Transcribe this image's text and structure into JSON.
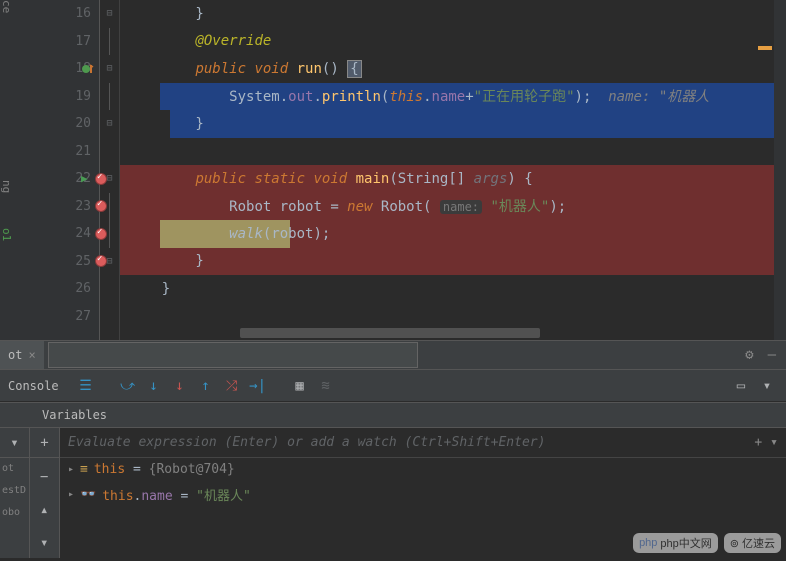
{
  "lines": {
    "16": "16",
    "17": "17",
    "18": "18",
    "19": "19",
    "20": "20",
    "21": "21",
    "22": "22",
    "23": "23",
    "24": "24",
    "25": "25",
    "26": "26",
    "27": "27"
  },
  "code": {
    "l16": "        }",
    "l17_ann": "@Override",
    "l18_public": "public ",
    "l18_void": "void ",
    "l18_run": "run",
    "l18_paren": "() ",
    "l18_brace": "{",
    "l19_sys": "System",
    "l19_dot1": ".",
    "l19_out": "out",
    "l19_dot2": ".",
    "l19_println": "println",
    "l19_open": "(",
    "l19_this": "this",
    "l19_dot3": ".",
    "l19_name": "name",
    "l19_plus": "+",
    "l19_str": "\"正在用轮子跑\"",
    "l19_close": ");",
    "l19_hint_name": "  name: ",
    "l19_hint_val": "\"机器人",
    "l20": "        }",
    "l22_public": "public ",
    "l22_static": "static ",
    "l22_void": "void ",
    "l22_main": "main",
    "l22_open": "(",
    "l22_string": "String",
    "l22_arr": "[] ",
    "l22_args": "args",
    "l22_close": ") {",
    "l23_robot1": "Robot ",
    "l23_robot2": "robot ",
    "l23_eq": "= ",
    "l23_new": "new ",
    "l23_robot3": "Robot",
    "l23_open": "( ",
    "l23_hint": "name:",
    "l23_sp": " ",
    "l23_str": "\"机器人\"",
    "l23_close": ");",
    "l24_walk": "walk",
    "l24_open": "(",
    "l24_robot": "robot",
    "l24_close": ");",
    "l25": "        }",
    "l26": "    }"
  },
  "tab": {
    "name": "ot",
    "close": "×"
  },
  "toolbar": {
    "console": "Console"
  },
  "variables": {
    "header": "Variables"
  },
  "watch": {
    "placeholder": "Evaluate expression (Enter) or add a watch (Ctrl+Shift+Enter)",
    "v1_this": "this",
    "v1_eq": " = ",
    "v1_val": "{Robot@704}",
    "v2_this": "this",
    "v2_dot": ".",
    "v2_name": "name",
    "v2_eq": " = ",
    "v2_val": "\"机器人\""
  },
  "sidebar_items": {
    "i1": "ot",
    "i2": "estD",
    "i3": "obo"
  },
  "left_labels": {
    "l1": "ce",
    "l2": "ng",
    "l3": "o1"
  },
  "watermarks": {
    "w1": "php中文网",
    "w2": "亿速云"
  }
}
